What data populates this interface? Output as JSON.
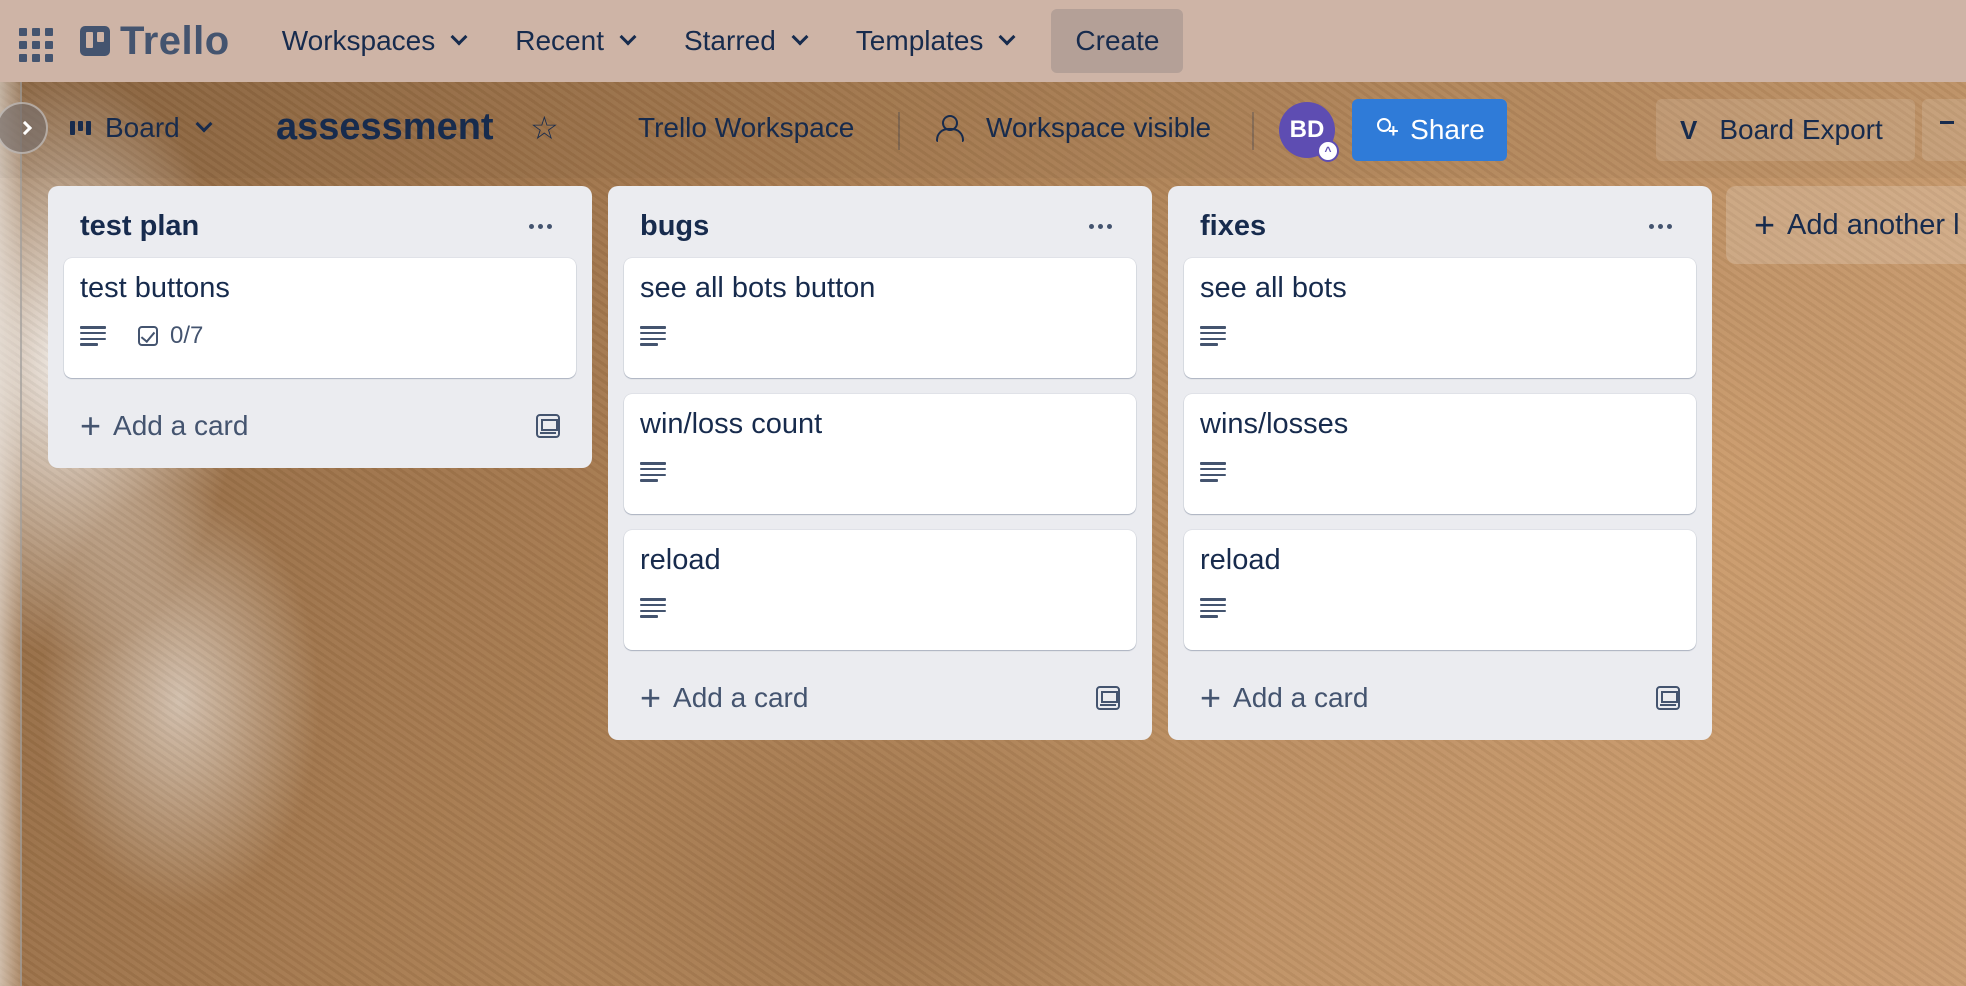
{
  "topnav": {
    "logo_text": "Trello",
    "items": [
      {
        "label": "Workspaces"
      },
      {
        "label": "Recent"
      },
      {
        "label": "Starred"
      },
      {
        "label": "Templates"
      }
    ],
    "create_label": "Create"
  },
  "board": {
    "view_label": "Board",
    "title": "assessment",
    "workspace_name": "Trello Workspace",
    "visibility_label": "Workspace visible",
    "avatar_initials": "BD",
    "share_label": "Share",
    "export_label": "Board Export"
  },
  "lists": [
    {
      "title": "test plan",
      "cards": [
        {
          "title": "test buttons",
          "checklist": "0/7"
        }
      ],
      "add_card_label": "Add a card"
    },
    {
      "title": "bugs",
      "cards": [
        {
          "title": "see all bots button"
        },
        {
          "title": "win/loss count"
        },
        {
          "title": "reload"
        }
      ],
      "add_card_label": "Add a card"
    },
    {
      "title": "fixes",
      "cards": [
        {
          "title": "see all bots"
        },
        {
          "title": "wins/losses"
        },
        {
          "title": "reload"
        }
      ],
      "add_card_label": "Add a card"
    }
  ],
  "add_list_label": "Add another l",
  "colors": {
    "topnav_bg": "#ceb4a6",
    "share_button": "#2f7bd8",
    "avatar": "#5e4db2",
    "list_bg": "#ebecf0"
  },
  "icons": [
    "apps-grid-icon",
    "trello-logo-icon",
    "chevron-down-icon",
    "board-view-icon",
    "star-icon",
    "people-icon",
    "share-person-add-icon",
    "description-icon",
    "checklist-icon",
    "plus-icon",
    "template-icon",
    "more-dots-icon"
  ]
}
